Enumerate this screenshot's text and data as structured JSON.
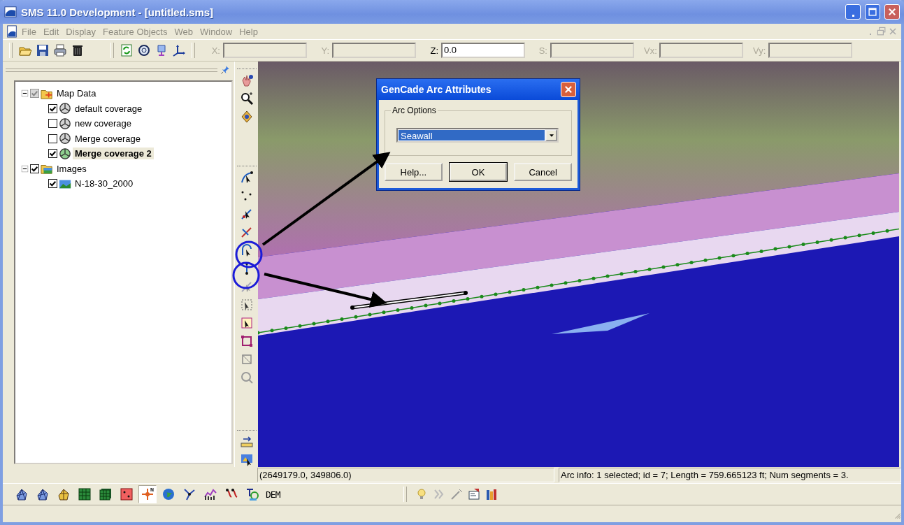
{
  "window": {
    "title": "SMS 11.0 Development - [untitled.sms]"
  },
  "menu": [
    {
      "label": "File",
      "disabled": true
    },
    {
      "label": "Edit",
      "disabled": true
    },
    {
      "label": "Display",
      "disabled": true
    },
    {
      "label": "Feature Objects",
      "disabled": true
    },
    {
      "label": "Web",
      "disabled": true
    },
    {
      "label": "Window",
      "disabled": true
    },
    {
      "label": "Help",
      "disabled": true
    }
  ],
  "coordinate_fields": [
    {
      "label": "X:",
      "disabled": true
    },
    {
      "label": "Y:",
      "disabled": true
    },
    {
      "label": "Z:",
      "disabled": false,
      "value": "0.0"
    },
    {
      "label": "S:",
      "disabled": true
    },
    {
      "label": "Vx:",
      "disabled": true
    },
    {
      "label": "Vy:",
      "disabled": true
    }
  ],
  "tree": [
    {
      "kind": "map-folder",
      "label": "Map Data",
      "checked": true,
      "disabled": true,
      "selected": false,
      "expanded": true,
      "children": [
        {
          "kind": "coverage",
          "label": "default coverage",
          "checked": true,
          "disabled": false,
          "selected": false
        },
        {
          "kind": "coverage",
          "label": "new coverage",
          "checked": false,
          "disabled": false,
          "selected": false
        },
        {
          "kind": "coverage",
          "label": "Merge coverage",
          "checked": false,
          "disabled": false,
          "selected": false
        },
        {
          "kind": "coverage",
          "label": "Merge coverage 2",
          "checked": true,
          "disabled": false,
          "selected": true
        }
      ]
    },
    {
      "kind": "image-folder",
      "label": "Images",
      "checked": true,
      "disabled": false,
      "selected": false,
      "expanded": true,
      "children": [
        {
          "kind": "image",
          "label": "N-18-30_2000",
          "checked": true,
          "disabled": false,
          "selected": false
        }
      ]
    }
  ],
  "dialog": {
    "title": "GenCade Arc Attributes",
    "group_label": "Arc Options",
    "dropdown": {
      "value": "Seawall"
    },
    "buttons": [
      {
        "label": "Help...",
        "default": false
      },
      {
        "label": "OK",
        "default": true
      },
      {
        "label": "Cancel",
        "default": false
      }
    ]
  },
  "status": {
    "cursor": "(2649179.0, 349806.0)",
    "info": "Arc info: 1 selected; id = 7; Length = 759.665123 ft; Num segments = 3."
  },
  "modules": [
    {
      "kind": "mesh",
      "selected": false
    },
    {
      "kind": "mesh",
      "selected": false
    },
    {
      "kind": "quadtree",
      "selected": false
    },
    {
      "kind": "cartesian-grid",
      "selected": false
    },
    {
      "kind": "cartesian-grid-3d",
      "selected": false
    },
    {
      "kind": "scatter",
      "selected": false
    },
    {
      "kind": "map",
      "selected": true
    },
    {
      "kind": "gis",
      "selected": false
    },
    {
      "kind": "network",
      "selected": false
    },
    {
      "kind": "chart",
      "selected": false
    },
    {
      "kind": "particle",
      "selected": false
    },
    {
      "kind": "annotation",
      "selected": false
    },
    {
      "kind": "dem",
      "selected": false,
      "label": "DEM"
    }
  ]
}
